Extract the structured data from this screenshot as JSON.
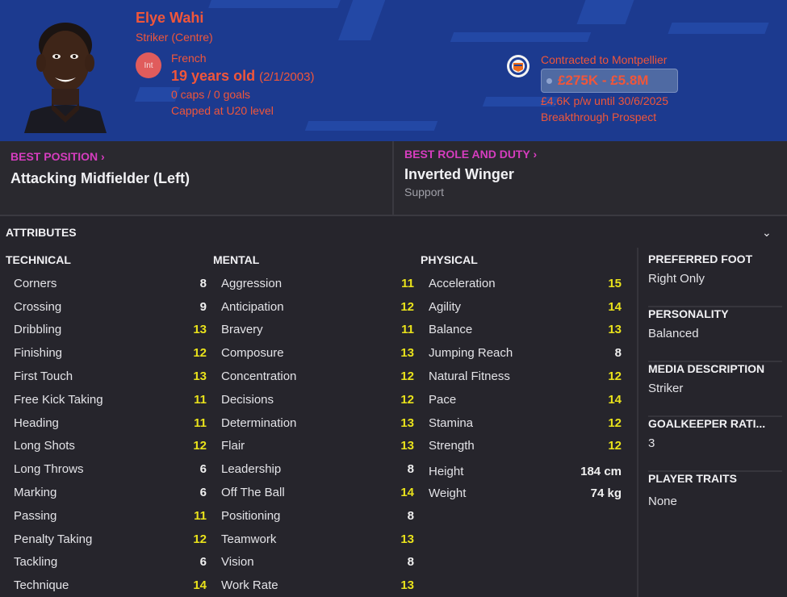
{
  "player": {
    "name": "Elye Wahi",
    "position": "Striker (Centre)",
    "int_badge": "Int",
    "nationality": "French",
    "age": "19 years old",
    "dob": "(2/1/2003)",
    "caps": "0 caps / 0 goals",
    "capped_level": "Capped at U20 level"
  },
  "contract": {
    "text": "Contracted to Montpellier",
    "value": "£275K - £5.8M",
    "wage": "£4.6K p/w until 30/6/2025",
    "status": "Breakthrough Prospect"
  },
  "best_position": {
    "label": "BEST POSITION",
    "value": "Attacking Midfielder (Left)"
  },
  "best_role": {
    "label": "BEST ROLE AND DUTY",
    "value": "Inverted Winger",
    "duty": "Support"
  },
  "attributes": {
    "title": "ATTRIBUTES",
    "technical": {
      "title": "TECHNICAL",
      "rows": [
        {
          "name": "Corners",
          "value": "8"
        },
        {
          "name": "Crossing",
          "value": "9"
        },
        {
          "name": "Dribbling",
          "value": "13"
        },
        {
          "name": "Finishing",
          "value": "12"
        },
        {
          "name": "First Touch",
          "value": "13"
        },
        {
          "name": "Free Kick Taking",
          "value": "11"
        },
        {
          "name": "Heading",
          "value": "11"
        },
        {
          "name": "Long Shots",
          "value": "12"
        },
        {
          "name": "Long Throws",
          "value": "6"
        },
        {
          "name": "Marking",
          "value": "6"
        },
        {
          "name": "Passing",
          "value": "11"
        },
        {
          "name": "Penalty Taking",
          "value": "12"
        },
        {
          "name": "Tackling",
          "value": "6"
        },
        {
          "name": "Technique",
          "value": "14"
        }
      ]
    },
    "mental": {
      "title": "MENTAL",
      "rows": [
        {
          "name": "Aggression",
          "value": "11"
        },
        {
          "name": "Anticipation",
          "value": "12"
        },
        {
          "name": "Bravery",
          "value": "11"
        },
        {
          "name": "Composure",
          "value": "13"
        },
        {
          "name": "Concentration",
          "value": "12"
        },
        {
          "name": "Decisions",
          "value": "12"
        },
        {
          "name": "Determination",
          "value": "13"
        },
        {
          "name": "Flair",
          "value": "13"
        },
        {
          "name": "Leadership",
          "value": "8"
        },
        {
          "name": "Off The Ball",
          "value": "14"
        },
        {
          "name": "Positioning",
          "value": "8"
        },
        {
          "name": "Teamwork",
          "value": "13"
        },
        {
          "name": "Vision",
          "value": "8"
        },
        {
          "name": "Work Rate",
          "value": "13"
        }
      ]
    },
    "physical": {
      "title": "PHYSICAL",
      "rows": [
        {
          "name": "Acceleration",
          "value": "15"
        },
        {
          "name": "Agility",
          "value": "14"
        },
        {
          "name": "Balance",
          "value": "13"
        },
        {
          "name": "Jumping Reach",
          "value": "8"
        },
        {
          "name": "Natural Fitness",
          "value": "12"
        },
        {
          "name": "Pace",
          "value": "14"
        },
        {
          "name": "Stamina",
          "value": "12"
        },
        {
          "name": "Strength",
          "value": "12"
        }
      ],
      "height_label": "Height",
      "height": "184 cm",
      "weight_label": "Weight",
      "weight": "74 kg"
    }
  },
  "side": {
    "foot_title": "PREFERRED FOOT",
    "foot": "Right Only",
    "personality_title": "PERSONALITY",
    "personality": "Balanced",
    "media_title": "MEDIA DESCRIPTION",
    "media": "Striker",
    "gk_title": "GOALKEEPER RATI...",
    "gk": "3",
    "traits_title": "PLAYER TRAITS",
    "traits": "None"
  },
  "colors": {
    "header_bg": "#1c3a8f",
    "accent_orange": "#f0563a",
    "accent_magenta": "#d63dbf",
    "high_value": "#e9e21b"
  }
}
